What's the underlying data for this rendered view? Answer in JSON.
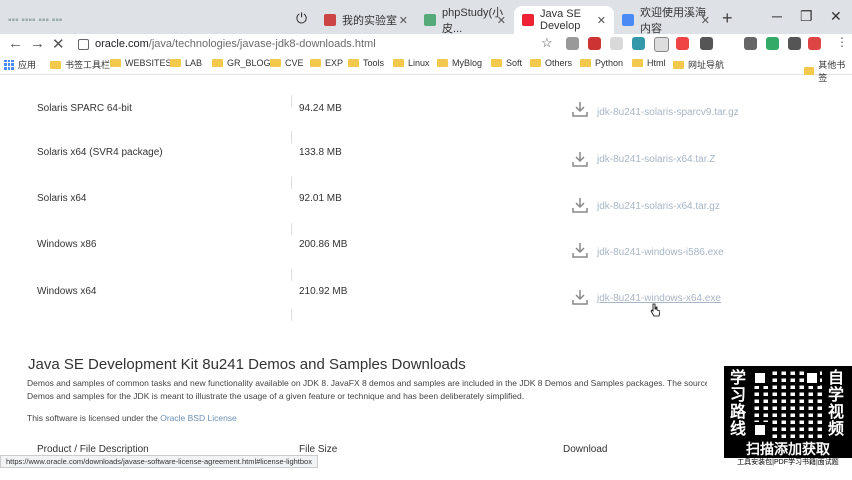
{
  "tabs": [
    {
      "title": "",
      "faded": true
    },
    {
      "title": "我的实验室"
    },
    {
      "title": "phpStudy(小皮..."
    },
    {
      "title": "Java SE Develop",
      "active": true
    },
    {
      "title": "欢迎使用溪海内容"
    }
  ],
  "address": {
    "host": "oracle.com",
    "path": "/java/technologies/javase-jdk8-downloads.html"
  },
  "bookmarks": [
    "应用",
    "书签工具栏",
    "WEBSITES",
    "LAB",
    "GR_BLOG",
    "CVE",
    "EXP",
    "Tools",
    "Linux",
    "MyBlog",
    "Soft",
    "Others",
    "Python",
    "Html",
    "网址导航",
    "其他书签"
  ],
  "downloads": [
    {
      "product": "Solaris SPARC 64-bit",
      "size": "94.24 MB",
      "file": "jdk-8u241-solaris-sparcv9.tar.gz"
    },
    {
      "product": "Solaris x64 (SVR4 package)",
      "size": "133.8 MB",
      "file": "jdk-8u241-solaris-x64.tar.Z"
    },
    {
      "product": "Solaris x64",
      "size": "92.01 MB",
      "file": "jdk-8u241-solaris-x64.tar.gz"
    },
    {
      "product": "Windows x86",
      "size": "200.86 MB",
      "file": "jdk-8u241-windows-i586.exe"
    },
    {
      "product": "Windows x64",
      "size": "210.92 MB",
      "file": "jdk-8u241-windows-x64.exe"
    }
  ],
  "demos": {
    "heading": "Java SE Development Kit 8u241 Demos and Samples Downloads",
    "para1": "Demos and samples of common tasks and new functionality available on JDK 8. JavaFX 8 demos and samples are included in the JDK 8 Demos and Samples packages. The source co",
    "para2": "Demos and samples for the JDK is meant to illustrate the usage of a given feature or technique and has been deliberately simplified.",
    "license_prefix": "This software is licensed under the ",
    "license_link": "Oracle BSD License",
    "col_product": "Product / File Description",
    "col_size": "File Size",
    "col_download": "Download"
  },
  "status_url": "https://www.oracle.com/downloads/javase-software-license-agreement.html#license-lightbox",
  "promo": {
    "left": [
      "学",
      "习",
      "路",
      "线"
    ],
    "right": [
      "自",
      "学",
      "视",
      "频"
    ],
    "cta": "扫描添加获取",
    "sub": "工具安装包|PDF学习书籍|面试题"
  },
  "colors": {
    "link": "#6b8fb4",
    "file_link": "#a7b6c6",
    "tabstrip": "#dee1e6"
  }
}
